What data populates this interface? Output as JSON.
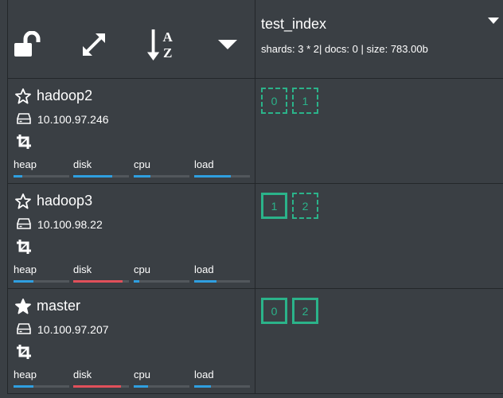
{
  "colors": {
    "background": "#3a3f44",
    "border": "#23272a",
    "bar_ok": "#2f9fe0",
    "bar_warn": "#e0505a",
    "bar_track": "#52575c",
    "shard": "#2bb38a"
  },
  "toolbar": {
    "icons": [
      "unlock-icon",
      "expand-icon",
      "sort-alpha-icon",
      "caret-down-icon"
    ]
  },
  "index": {
    "name": "test_index",
    "info": "shards: 3 * 2| docs: 0 | size: 783.00b"
  },
  "nodes": [
    {
      "name": "hadoop2",
      "ip": "10.100.97.246",
      "master": false,
      "stats": [
        {
          "label": "heap",
          "level": 0.15,
          "status": "ok"
        },
        {
          "label": "disk",
          "level": 0.7,
          "status": "ok"
        },
        {
          "label": "cpu",
          "level": 0.3,
          "status": "ok"
        },
        {
          "label": "load",
          "level": 0.65,
          "status": "ok"
        }
      ],
      "shards": [
        {
          "label": "0",
          "type": "replica"
        },
        {
          "label": "1",
          "type": "replica"
        }
      ]
    },
    {
      "name": "hadoop3",
      "ip": "10.100.98.22",
      "master": false,
      "stats": [
        {
          "label": "heap",
          "level": 0.35,
          "status": "ok"
        },
        {
          "label": "disk",
          "level": 0.88,
          "status": "warn"
        },
        {
          "label": "cpu",
          "level": 0.1,
          "status": "ok"
        },
        {
          "label": "load",
          "level": 0.4,
          "status": "ok"
        }
      ],
      "shards": [
        {
          "label": "1",
          "type": "primary"
        },
        {
          "label": "2",
          "type": "replica"
        }
      ]
    },
    {
      "name": "master",
      "ip": "10.100.97.207",
      "master": true,
      "stats": [
        {
          "label": "heap",
          "level": 0.35,
          "status": "ok"
        },
        {
          "label": "disk",
          "level": 0.85,
          "status": "warn"
        },
        {
          "label": "cpu",
          "level": 0.25,
          "status": "ok"
        },
        {
          "label": "load",
          "level": 0.3,
          "status": "ok"
        }
      ],
      "shards": [
        {
          "label": "0",
          "type": "primary"
        },
        {
          "label": "2",
          "type": "primary"
        }
      ]
    }
  ]
}
